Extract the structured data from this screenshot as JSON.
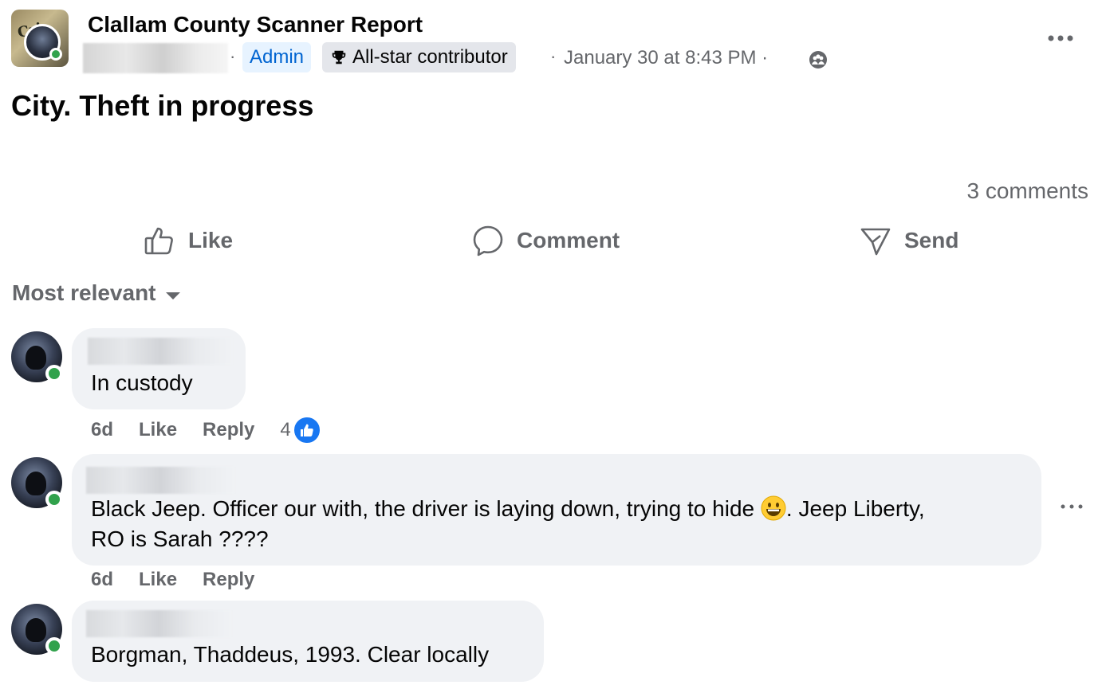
{
  "post": {
    "group_name": "Clallam County Scanner Report",
    "admin_badge": "Admin",
    "allstar_badge": "All-star contributor",
    "timestamp": "January 30 at 8:43 PM",
    "separator": "·",
    "text": "City. Theft in progress",
    "comments_count": "3 comments"
  },
  "actions": {
    "like": "Like",
    "comment": "Comment",
    "send": "Send"
  },
  "sort": {
    "label": "Most relevant"
  },
  "comments": [
    {
      "text": "In custody",
      "time": "6d",
      "like_label": "Like",
      "reply_label": "Reply",
      "reaction_count": "4"
    },
    {
      "text_part1": "Black Jeep. Officer our with, the driver is laying down, trying to hide",
      "text_part2": ". Jeep Liberty,",
      "text_line2": "RO is Sarah ????",
      "emoji": "grinning-face-emoji",
      "time": "6d",
      "like_label": "Like",
      "reply_label": "Reply"
    },
    {
      "text": "Borgman, Thaddeus, 1993. Clear locally"
    }
  ],
  "colors": {
    "accent_blue": "#1877f2",
    "admin_blue": "#0064d1",
    "secondary_text": "#65676b",
    "bubble_bg": "#f0f2f5",
    "online_green": "#31a24c"
  }
}
